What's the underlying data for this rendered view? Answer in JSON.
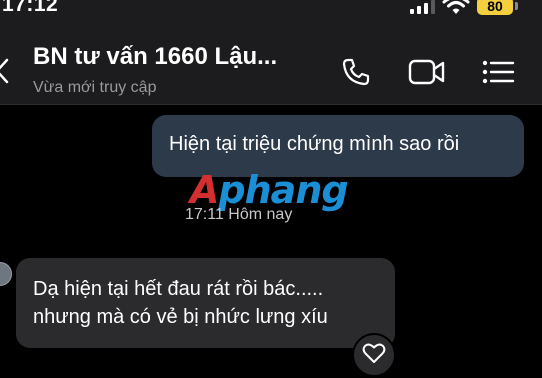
{
  "status_bar": {
    "time": "17:12",
    "battery": "80"
  },
  "header": {
    "title": "BN tư vấn 1660 Lậu...",
    "subtitle": "Vừa mới truy cập",
    "call_icon": "phone-icon",
    "video_icon": "video-camera-icon",
    "menu_icon": "list-menu-icon"
  },
  "messages": {
    "outgoing": {
      "text": "Hiện tại triệu chứng mình sao rồi"
    },
    "timestamp": "17:11 Hôm nay",
    "incoming": {
      "line1": "Dạ hiện tại hết đau rát rồi bác.....",
      "line2": "nhưng mà có vẻ bị nhức lưng xíu"
    }
  },
  "watermark": {
    "prefix": "A",
    "rest": "phang"
  },
  "colors": {
    "background": "#000000",
    "header_bg": "#1c1c1e",
    "outgoing_bubble": "#2c3a4a",
    "incoming_bubble": "#2b2b2d",
    "battery": "#f4d03f",
    "watermark_red": "#d32f2f",
    "watermark_blue": "#1a8fd6"
  }
}
